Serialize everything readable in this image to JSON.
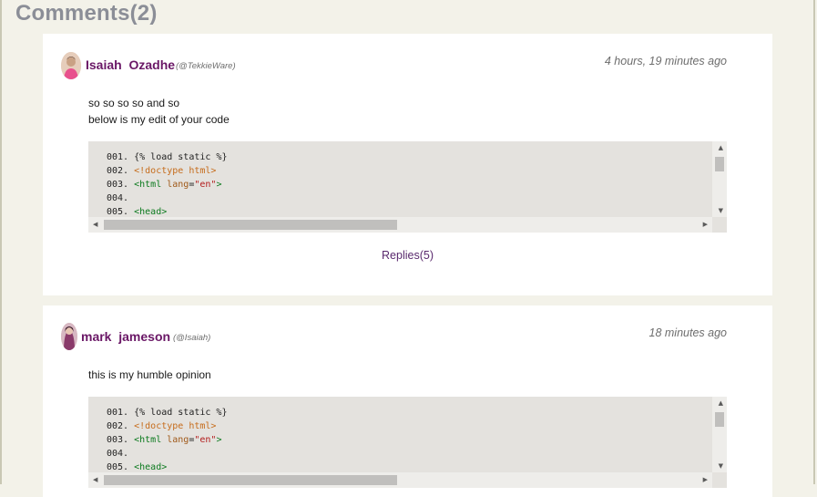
{
  "section": {
    "heading": "Comments(2)"
  },
  "comments": [
    {
      "author": "Isaiah  Ozadhe",
      "handle": "(@TekkieWare)",
      "time": "4 hours, 19 minutes ago",
      "lines": [
        "so so so so and so",
        "below is my edit of your code"
      ],
      "replies_label": "Replies(5)"
    },
    {
      "author": "mark  jameson",
      "handle": "(@Isaiah)",
      "time": "18 minutes ago",
      "lines": [
        "this is my humble opinion"
      ]
    }
  ],
  "code_lines": [
    {
      "num": "001.",
      "parts": [
        {
          "t": "{% load static %}",
          "c": ""
        }
      ]
    },
    {
      "num": "002.",
      "parts": [
        {
          "t": "<!doctype html>",
          "c": "tok-doc"
        }
      ]
    },
    {
      "num": "003.",
      "parts": [
        {
          "t": "<html ",
          "c": "tok-tag"
        },
        {
          "t": "lang",
          "c": "tok-attr"
        },
        {
          "t": "=",
          "c": ""
        },
        {
          "t": "\"en\"",
          "c": "tok-str"
        },
        {
          "t": ">",
          "c": "tok-tag"
        }
      ]
    },
    {
      "num": "004.",
      "parts": []
    },
    {
      "num": "005.",
      "parts": [
        {
          "t": "<head>",
          "c": "tok-tag"
        }
      ]
    }
  ],
  "icons": {
    "scroll_up": "triangle-up",
    "scroll_down": "triangle-down",
    "scroll_left": "triangle-left",
    "scroll_right": "triangle-right"
  },
  "colors": {
    "author": "#6a1766",
    "heading": "#8b8e97",
    "background": "#f3f2e9"
  }
}
